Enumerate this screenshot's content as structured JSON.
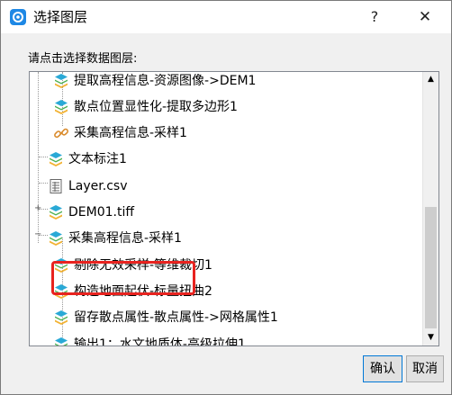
{
  "dialog": {
    "title": "选择图层",
    "help_label": "?",
    "close_label": "✕",
    "prompt": "请点击选择数据图层:",
    "ok_label": "确认",
    "cancel_label": "取消"
  },
  "tree": {
    "items": [
      {
        "label": "提取高程信息-资源图像->DEM1",
        "icon": "layer-stack-icon",
        "level": 1
      },
      {
        "label": "散点位置显性化-提取多边形1",
        "icon": "layer-stack-icon",
        "level": 1
      },
      {
        "label": "采集高程信息-采样1",
        "icon": "link-icon",
        "level": 1
      },
      {
        "label": "文本标注1",
        "icon": "layer-stack-icon",
        "level": 0
      },
      {
        "label": "Layer.csv",
        "icon": "table-icon",
        "level": 0
      },
      {
        "label": "DEM01.tiff",
        "icon": "layer-stack-icon",
        "level": 0,
        "highlighted": true
      },
      {
        "label": "采集高程信息-采样1",
        "icon": "layer-stack-icon",
        "level": 0,
        "expanded": true
      },
      {
        "label": "剔除无效采样-等维裁切1",
        "icon": "layer-stack-icon",
        "level": 1
      },
      {
        "label": "构造地面起伏-标量扭曲2",
        "icon": "layer-stack-icon",
        "level": 1
      },
      {
        "label": "留存散点属性-散点属性->网格属性1",
        "icon": "layer-stack-icon",
        "level": 1
      },
      {
        "label": "输出1：水文地质体-高级拉伸1",
        "icon": "layer-stack-icon",
        "level": 1
      }
    ]
  },
  "colors": {
    "highlight": "#e8231f",
    "layer_top": "#2aa9d6",
    "layer_mid": "#4caf50",
    "layer_bottom": "#f2b233"
  }
}
